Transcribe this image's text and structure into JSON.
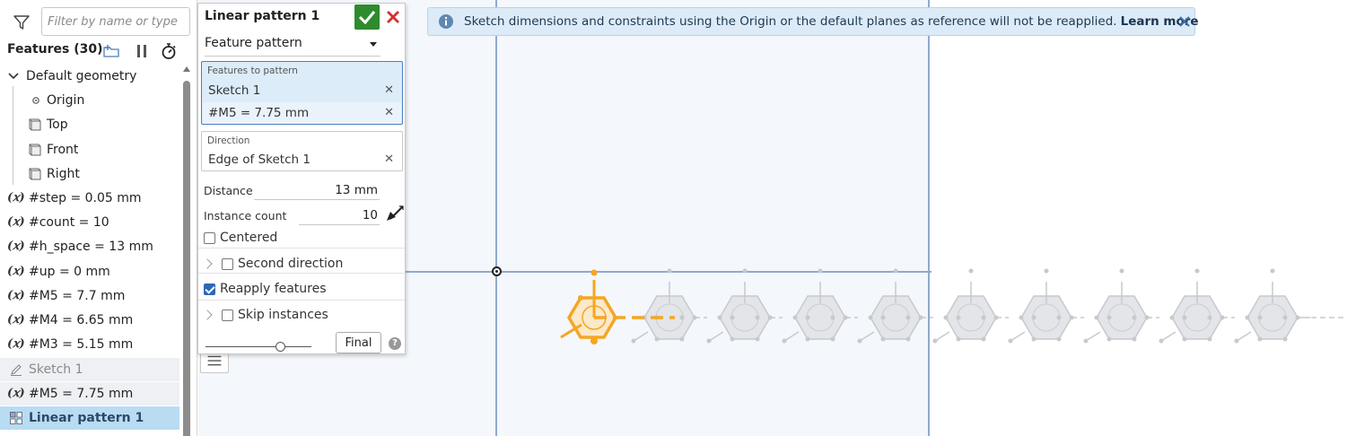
{
  "sidebar": {
    "filter_placeholder": "Filter by name or type",
    "features_title": "Features (30)",
    "tree": {
      "default_geometry": "Default geometry",
      "origin": "Origin",
      "top": "Top",
      "front": "Front",
      "right": "Right",
      "var_symbol": "(𝑥)",
      "vars": [
        "#step = 0.05 mm",
        "#count = 10",
        "#h_space = 13 mm",
        "#up = 0 mm",
        "#M5 = 7.7 mm",
        "#M4 = 6.65 mm",
        "#M3 = 5.15 mm"
      ],
      "sketch": "Sketch 1",
      "var_after_sketch": "#M5 = 7.75 mm",
      "pattern": "Linear pattern 1"
    }
  },
  "dialog": {
    "title": "Linear pattern 1",
    "type_value": "Feature pattern",
    "features_caption": "Features to pattern",
    "features": [
      "Sketch 1",
      "#M5 = 7.75 mm"
    ],
    "remove_glyph": "✕",
    "direction_caption": "Direction",
    "direction_value": "Edge of Sketch 1",
    "distance_label": "Distance",
    "distance_value": "13 mm",
    "count_label": "Instance count",
    "count_value": "10",
    "centered_label": "Centered",
    "second_direction_label": "Second direction",
    "reapply_label": "Reapply features",
    "skip_label": "Skip instances",
    "final_label": "Final",
    "help_glyph": "?"
  },
  "banner": {
    "text": "Sketch dimensions and constraints using the Origin or the default planes as reference will not be reapplied.",
    "link": "Learn more"
  },
  "colors": {
    "accent_blue": "#2d68b8",
    "ok_green": "#2e8b2e",
    "cancel_red": "#d32f2f",
    "highlight_orange": "#f5a623",
    "plane_edge": "#8fa9cc"
  }
}
